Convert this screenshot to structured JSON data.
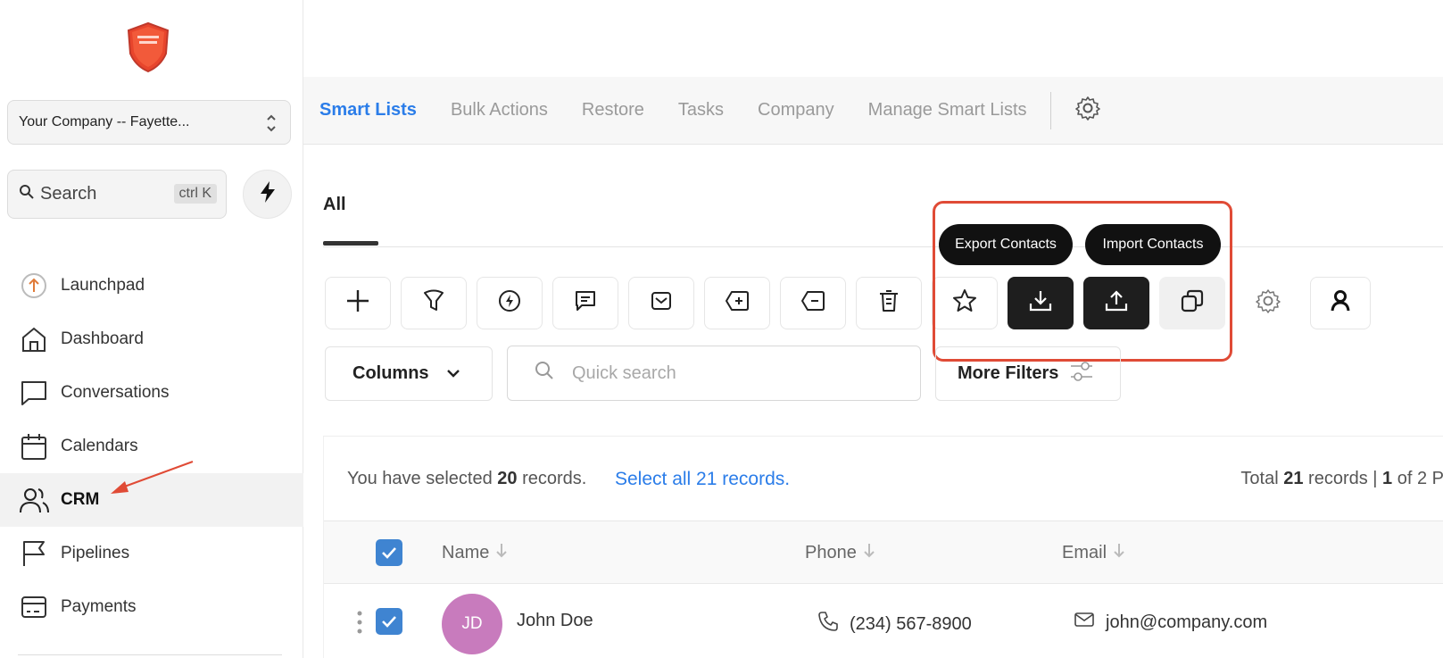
{
  "sidebar": {
    "company": "Your Company -- Fayette...",
    "search_label": "Search",
    "search_shortcut": "ctrl K",
    "items": [
      {
        "label": "Launchpad",
        "icon": "launchpad-icon"
      },
      {
        "label": "Dashboard",
        "icon": "home-icon"
      },
      {
        "label": "Conversations",
        "icon": "chat-icon"
      },
      {
        "label": "Calendars",
        "icon": "calendar-icon"
      },
      {
        "label": "CRM",
        "icon": "users-icon",
        "active": true
      },
      {
        "label": "Pipelines",
        "icon": "flag-icon"
      },
      {
        "label": "Payments",
        "icon": "payments-icon"
      }
    ]
  },
  "topnav": {
    "tabs": [
      "Smart Lists",
      "Bulk Actions",
      "Restore",
      "Tasks",
      "Company",
      "Manage Smart Lists"
    ],
    "active": "Smart Lists"
  },
  "subtabs": {
    "all": "All"
  },
  "tooltips": {
    "export": "Export Contacts",
    "import": "Import Contacts"
  },
  "toolbar": {
    "icons": [
      "plus-icon",
      "filter-icon",
      "workflow-icon",
      "message-icon",
      "email-icon",
      "add-tag-icon",
      "remove-tag-icon",
      "delete-icon",
      "star-icon",
      "export-icon",
      "import-icon",
      "duplicate-icon",
      "settings-icon",
      "person-icon"
    ]
  },
  "filters": {
    "columns_label": "Columns",
    "quick_search_placeholder": "Quick search",
    "more_filters_label": "More Filters"
  },
  "records": {
    "selected_prefix": "You have selected",
    "selected_count": "20",
    "selected_suffix": "records.",
    "select_all": "Select all 21 records.",
    "total_prefix": "Total",
    "total_count": "21",
    "total_mid": "records |",
    "page_current": "1",
    "page_suffix": "of 2 P"
  },
  "table": {
    "columns": [
      "Name",
      "Phone",
      "Email"
    ],
    "rows": [
      {
        "initials": "JD",
        "name": "John Doe",
        "phone": "(234) 567-8900",
        "email": "john@company.com"
      }
    ]
  },
  "colors": {
    "accent": "#2b7de9",
    "checkbox": "#3f84d1",
    "avatar": "#c87bbd",
    "highlight": "#e04b36",
    "dark_button": "#1e1e1e"
  }
}
